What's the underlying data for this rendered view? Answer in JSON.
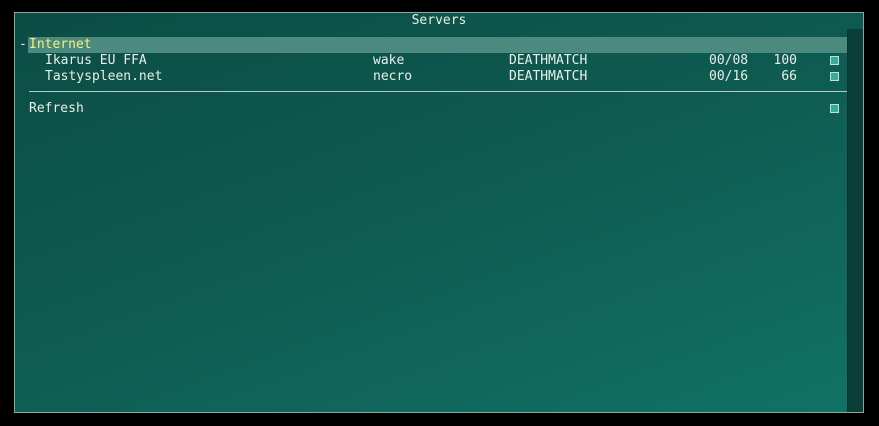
{
  "window": {
    "title": "Servers"
  },
  "group": {
    "toggle": "-",
    "label": "Internet"
  },
  "servers": [
    {
      "name": "Ikarus EU FFA",
      "map": "wake",
      "mode": "DEATHMATCH",
      "players": "00/08",
      "ping": "100"
    },
    {
      "name": "Tastyspleen.net",
      "map": "necro",
      "mode": "DEATHMATCH",
      "players": "00/16",
      "ping": "66"
    }
  ],
  "actions": {
    "refresh_label": "Refresh"
  },
  "colors": {
    "selection_bg": "#4c8a80",
    "selection_text": "#f5f27c",
    "panel_gradient_start": "#0c4d44",
    "panel_gradient_end": "#117266",
    "checkbox_fill": "#3aa99a"
  }
}
